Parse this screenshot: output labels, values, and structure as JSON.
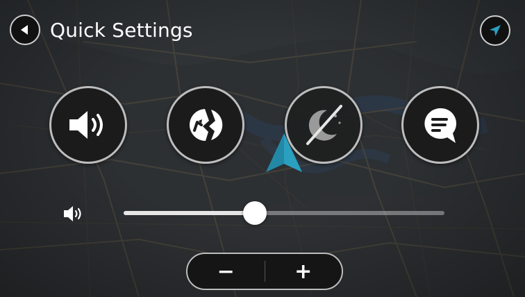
{
  "header": {
    "title": "Quick Settings",
    "back_icon": "back-arrow-icon",
    "nav_icon": "navigation-arrow-icon"
  },
  "quick_settings": [
    {
      "name": "sound",
      "icon": "speaker-icon",
      "state": "on"
    },
    {
      "name": "traffic",
      "icon": "traffic-incident-icon",
      "state": "on"
    },
    {
      "name": "night-mode",
      "icon": "night-mode-off-icon",
      "state": "off"
    },
    {
      "name": "voice-instructions",
      "icon": "speech-bubble-icon",
      "state": "on"
    }
  ],
  "volume": {
    "icon": "volume-icon",
    "level_fraction": 0.41
  },
  "zoom": {
    "out_label": "−",
    "in_label": "+"
  },
  "colors": {
    "accent_teal": "#1e8fa8",
    "button_fill": "#1b1b1b",
    "button_border": "#bdbdbd",
    "map_background": "#2b2e31"
  }
}
